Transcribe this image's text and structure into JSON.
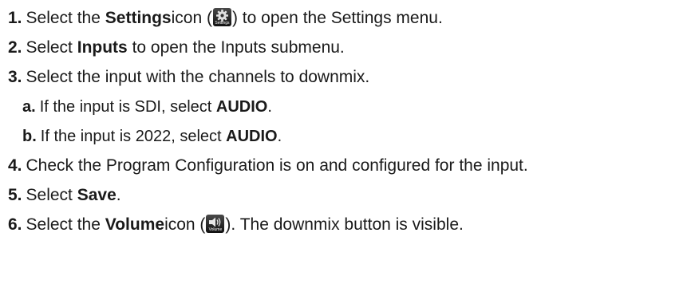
{
  "steps": [
    {
      "num": "1.",
      "parts": [
        "Select the ",
        "Settings",
        " icon (",
        ") to open the Settings menu."
      ],
      "icon": "settings-gear-icon",
      "icon_caption": "Settings"
    },
    {
      "num": "2.",
      "parts": [
        "Select ",
        "Inputs",
        " to open the Inputs  submenu."
      ]
    },
    {
      "num": "3.",
      "text": "Select the input with the channels to downmix."
    },
    {
      "num": "a.",
      "parts": [
        "If the input is SDI, select ",
        "AUDIO",
        "."
      ]
    },
    {
      "num": "b.",
      "parts": [
        "If the input is 2022, select ",
        "AUDIO",
        "."
      ]
    },
    {
      "num": "4.",
      "text": "Check the Program Configuration is on and configured for the input."
    },
    {
      "num": "5.",
      "parts": [
        "Select ",
        "Save",
        "."
      ]
    },
    {
      "num": "6.",
      "parts": [
        "Select the ",
        "Volume",
        " icon (",
        "). The downmix button is visible."
      ],
      "icon": "volume-speaker-icon",
      "icon_caption": "Volume"
    }
  ]
}
